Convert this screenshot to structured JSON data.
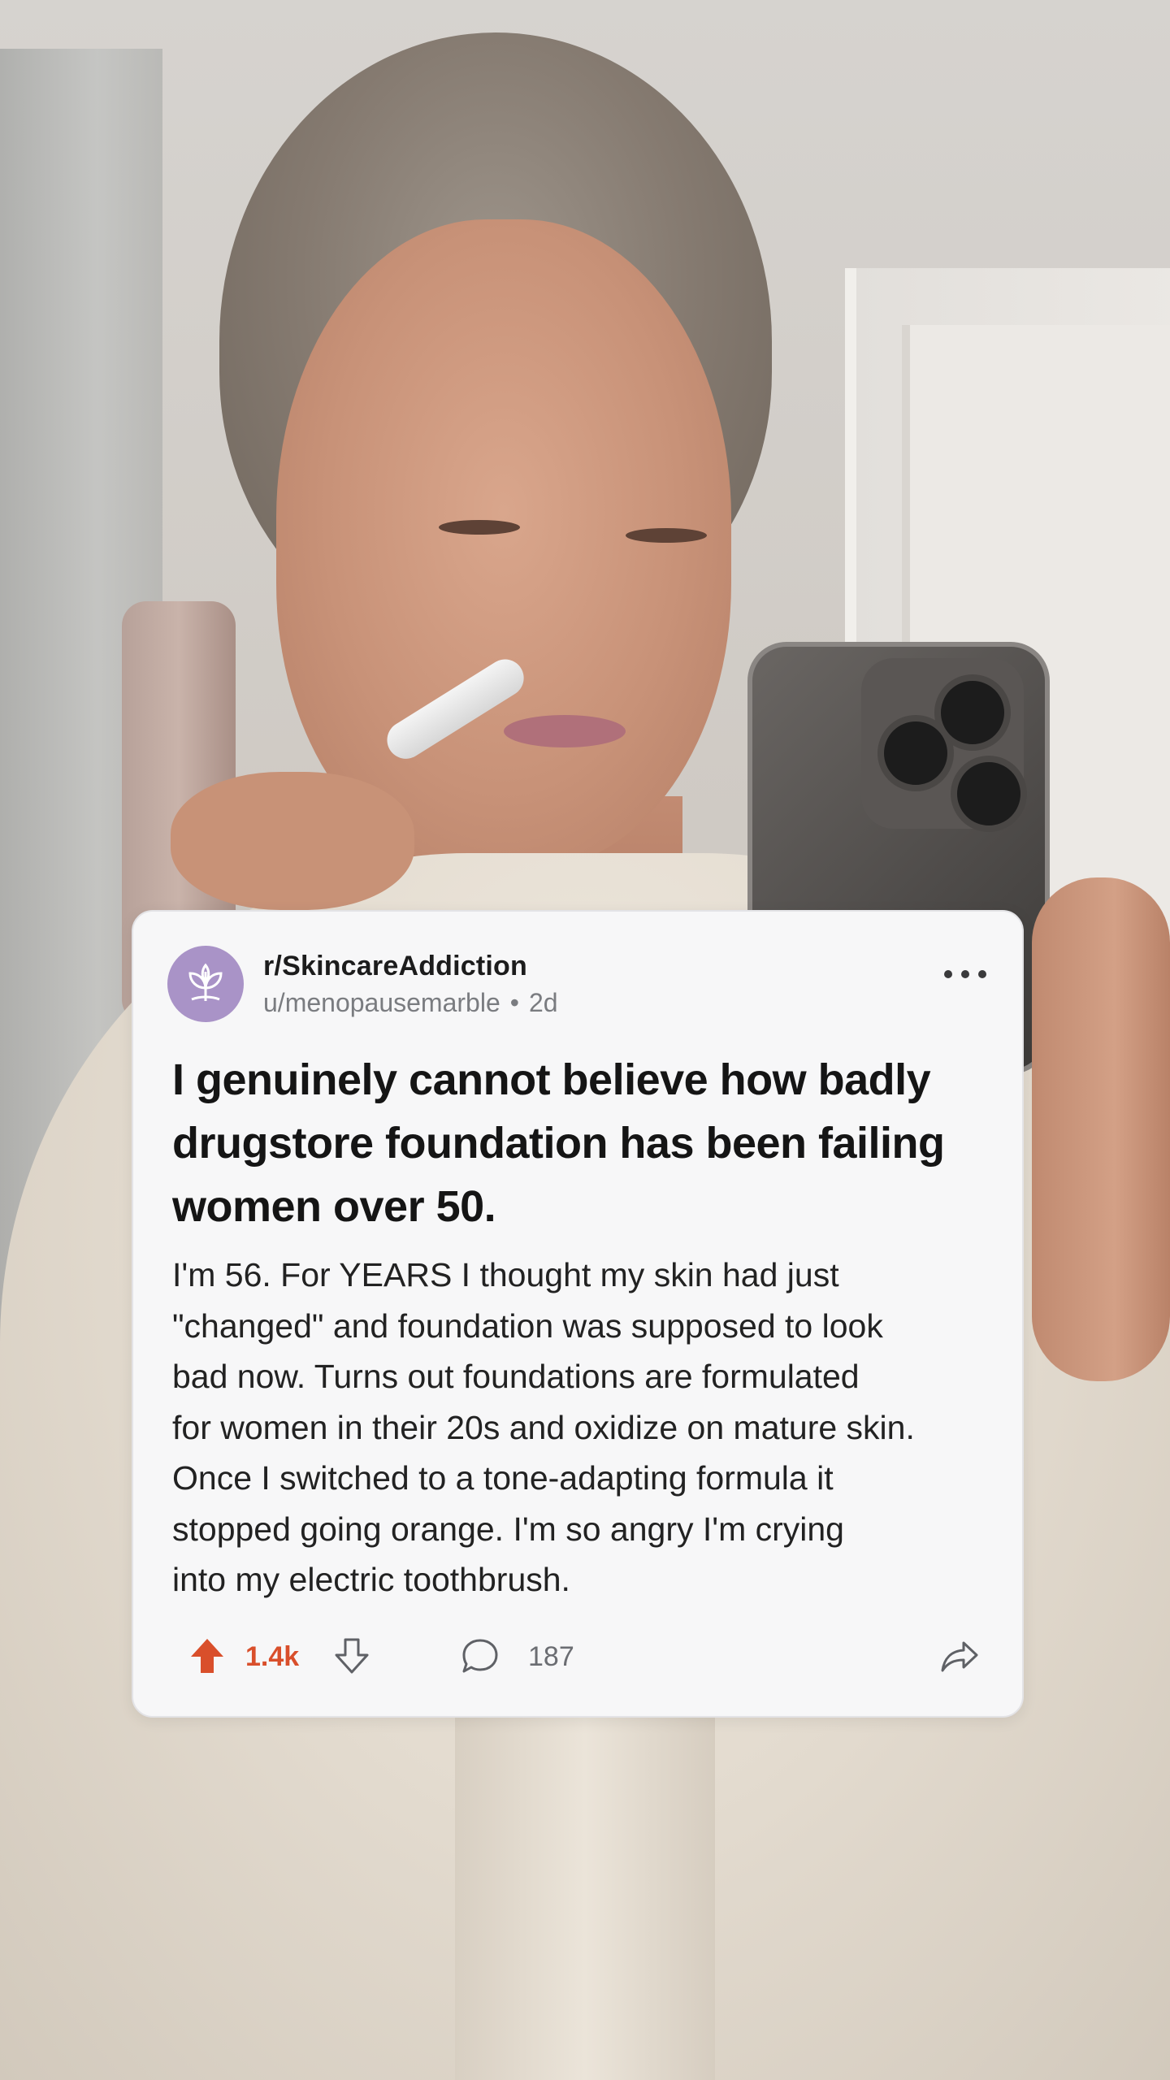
{
  "post": {
    "subreddit": "r/SkincareAddiction",
    "author": "u/menopausemarble",
    "separator": "•",
    "age": "2d",
    "title": "I genuinely cannot believe how badly drugstore foundation has been failing women over 50.",
    "body": "I'm 56. For YEARS I thought my skin had just\n\"changed\" and foundation was supposed to look\nbad now. Turns out foundations are formulated\nfor women in their 20s and oxidize on mature skin.\nOnce I switched to a tone-adapting formula it\nstopped going orange. I'm so angry I'm crying\ninto my electric toothbrush.",
    "upvotes": "1.4k",
    "comments": "187"
  },
  "colors": {
    "accent_upvote": "#d94f2b",
    "avatar_bg": "#a993c7",
    "card_bg": "#f7f7f8"
  },
  "icons": {
    "avatar": "leaf-icon",
    "more": "more-options-icon",
    "upvote": "upvote-arrow-icon",
    "downvote": "downvote-arrow-icon",
    "comment": "comment-bubble-icon",
    "share": "share-arrow-icon"
  }
}
